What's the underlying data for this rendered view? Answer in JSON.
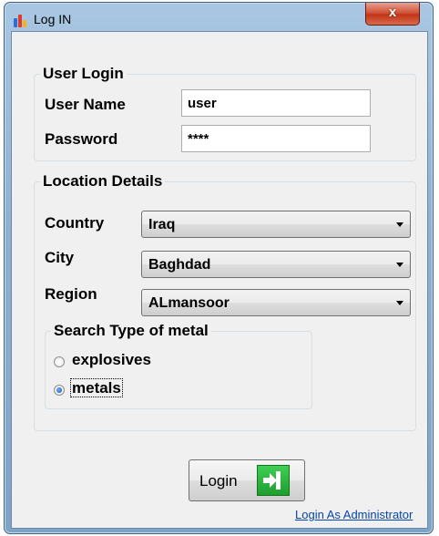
{
  "window": {
    "title": "Log IN",
    "close_glyph": "x"
  },
  "user_login": {
    "legend": "User Login",
    "username_label": "User Name",
    "username_value": "user",
    "password_label": "Password",
    "password_value": "****"
  },
  "location": {
    "legend": "Location Details",
    "country_label": "Country",
    "country_value": "Iraq",
    "city_label": "City",
    "city_value": "Baghdad",
    "region_label": "Region",
    "region_value": "ALmansoor"
  },
  "search_type": {
    "legend": "Search Type of metal",
    "options": [
      {
        "label": "explosives",
        "checked": false
      },
      {
        "label": "metals",
        "checked": true
      }
    ]
  },
  "actions": {
    "login_label": "Login",
    "admin_link": "Login As Administrator"
  },
  "colors": {
    "login_icon_green": "#1f9e2f",
    "link_blue": "#0645ad",
    "close_red": "#c13516"
  }
}
